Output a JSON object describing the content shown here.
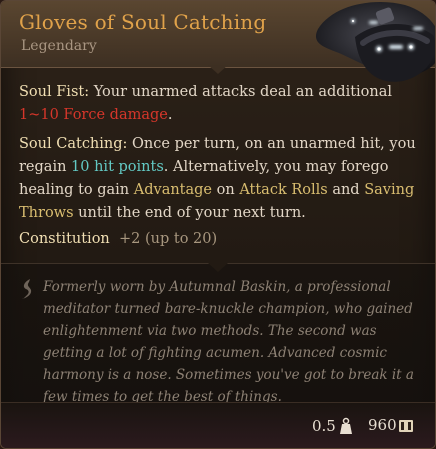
{
  "item": {
    "name": "Gloves of Soul Catching",
    "rarity": "Legendary"
  },
  "effects": {
    "soul_fist": {
      "label": "Soul Fist:",
      "text_before": " Your unarmed attacks deal an additional ",
      "damage": "1~10 Force damage",
      "text_after": "."
    },
    "soul_catching": {
      "label": "Soul Catching:",
      "text_1": " Once per turn, on an unarmed hit, you regain ",
      "heal": "10 hit points",
      "text_2": ". Alternatively, you may forego healing to gain ",
      "advantage": "Advantage",
      "text_3": " on ",
      "attack_rolls": "Attack Rolls",
      "text_4": " and ",
      "saving_throws": "Saving Throws",
      "text_5": " until the end of your next turn."
    },
    "constitution": {
      "label": "Constitution",
      "value": "+2 (up to 20)"
    }
  },
  "lore": {
    "text": "Formerly worn by Autumnal Baskin, a professional meditator turned bare-knuckle champion, who gained enlightenment via two methods. The second was getting a lot of fighting acumen. Advanced cosmic harmony is a nose. Sometimes you've got to break it a few times to get the best of things."
  },
  "footer": {
    "weight": "0.5",
    "price": "960"
  },
  "colors": {
    "title": "#e0a24a",
    "damage": "#d6362a",
    "heal": "#63c9c4",
    "keyword": "#d9bd70"
  },
  "icons": {
    "weight": "weight-icon",
    "price": "gold-coin-icon",
    "lore": "lore-quill-icon",
    "item": "gloves-item-icon"
  }
}
